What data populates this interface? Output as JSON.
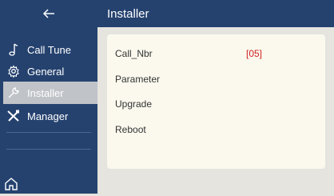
{
  "sidebar": {
    "back_icon": "left-arrow-icon",
    "items": [
      {
        "label": "Call Tune",
        "icon": "music-note-icon",
        "active": false
      },
      {
        "label": "General",
        "icon": "gear-icon",
        "active": false
      },
      {
        "label": "Installer",
        "icon": "wrench-icon",
        "active": true
      },
      {
        "label": "Manager",
        "icon": "tools-icon",
        "active": false
      }
    ],
    "home_icon": "home-icon"
  },
  "header": {
    "title": "Installer"
  },
  "content": {
    "rows": [
      {
        "label": "Call_Nbr",
        "value": "[05]"
      },
      {
        "label": "Parameter"
      },
      {
        "label": "Upgrade"
      },
      {
        "label": "Reboot"
      }
    ]
  },
  "colors": {
    "sidebar_bg": "#25426f",
    "active_item_bg": "#c0c3c8",
    "value_red": "#cc2222",
    "panel_bg": "#fbf9ee"
  }
}
